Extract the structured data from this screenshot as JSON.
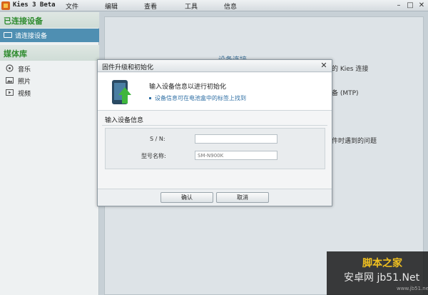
{
  "app": {
    "title": "Kies 3 Beta"
  },
  "menu": [
    "文件",
    "编辑",
    "查看",
    "工具",
    "信息"
  ],
  "window_controls": {
    "minimize": "–",
    "maximize": "□",
    "close": "✕"
  },
  "sidebar": {
    "connected_header": "已连接设备",
    "device_label": "请连接设备",
    "media_header": "媒体库",
    "media_items": [
      {
        "label": "音乐",
        "icon": "music-icon"
      },
      {
        "label": "照片",
        "icon": "photo-icon"
      },
      {
        "label": "视频",
        "icon": "video-icon"
      }
    ]
  },
  "background": {
    "connect_title": "设备连接",
    "line1": "的 Kies 连接",
    "line2": "备 (MTP)",
    "line3": "件时遇到的问题"
  },
  "dialog": {
    "title": "固件升级和初始化",
    "close": "✕",
    "heading": "输入设备信息以进行初始化",
    "note": "设备信息可在电池盒中的标签上找到",
    "section_label": "输入设备信息",
    "sn_label": "S / N:",
    "sn_value": "",
    "model_label": "型号名称:",
    "model_placeholder": "SM-N900K",
    "ok_button": "确认",
    "cancel_button": "取消"
  },
  "watermark": {
    "logo": "脚本之家",
    "text": "安卓网 jb51.Net",
    "url": "www.jb51.net"
  },
  "colors": {
    "accent": "#4f8fb2",
    "header_green": "#2e8b2e",
    "note_blue": "#2f6fa4",
    "arrow_green": "#3fb63d"
  }
}
